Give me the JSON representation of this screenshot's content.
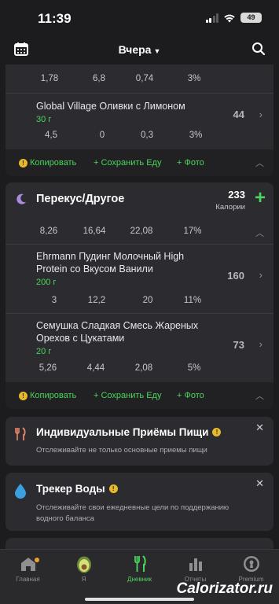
{
  "status": {
    "time": "11:39",
    "battery": "49"
  },
  "header": {
    "title": "Вчера"
  },
  "meal1": {
    "top_row_values": [
      "1,78",
      "6,8",
      "0,74",
      "3%"
    ],
    "item": {
      "name": "Global Village Оливки с Лимоном",
      "qty": "30 г",
      "calories": "44",
      "values": [
        "4,5",
        "0",
        "0,3",
        "3%"
      ]
    },
    "actions": {
      "copy": "Копировать",
      "save": "+ Сохранить Еду",
      "photo": "+ Фото"
    }
  },
  "meal2": {
    "title": "Перекус/Другое",
    "calories": "233",
    "calories_label": "Калории",
    "totals": [
      "8,26",
      "16,64",
      "22,08",
      "17%"
    ],
    "items": [
      {
        "name": "Ehrmann Пудинг Молочный High Protein со Вкусом Ванили",
        "qty": "200 г",
        "calories": "160",
        "values": [
          "3",
          "12,2",
          "20",
          "11%"
        ]
      },
      {
        "name": "Семушка Сладкая Смесь Жареных Орехов с Цукатами",
        "qty": "20 г",
        "calories": "73",
        "values": [
          "5,26",
          "4,44",
          "2,08",
          "5%"
        ]
      }
    ],
    "actions": {
      "copy": "Копировать",
      "save": "+ Сохранить Еду",
      "photo": "+ Фото"
    }
  },
  "promos": [
    {
      "title": "Индивидуальные Приёмы Пищи",
      "desc": "Отслеживайте не только основные приемы пищи"
    },
    {
      "title": "Трекер Воды",
      "desc": "Отслеживайте свои ежедневные цели по поддержанию водного баланса"
    }
  ],
  "tabs": [
    {
      "label": "Главная",
      "icon": "home-icon"
    },
    {
      "label": "Я",
      "icon": "avocado-icon"
    },
    {
      "label": "Дневник",
      "icon": "fork-knife-icon"
    },
    {
      "label": "Отчеты",
      "icon": "bar-chart-icon"
    },
    {
      "label": "Premium",
      "icon": "keyhole-icon"
    }
  ],
  "watermark": "Calorizator.ru",
  "colors": {
    "accent": "#4cd45c",
    "background": "#1c1c1e",
    "card": "#2c2c30",
    "coin": "#e8b92a"
  }
}
